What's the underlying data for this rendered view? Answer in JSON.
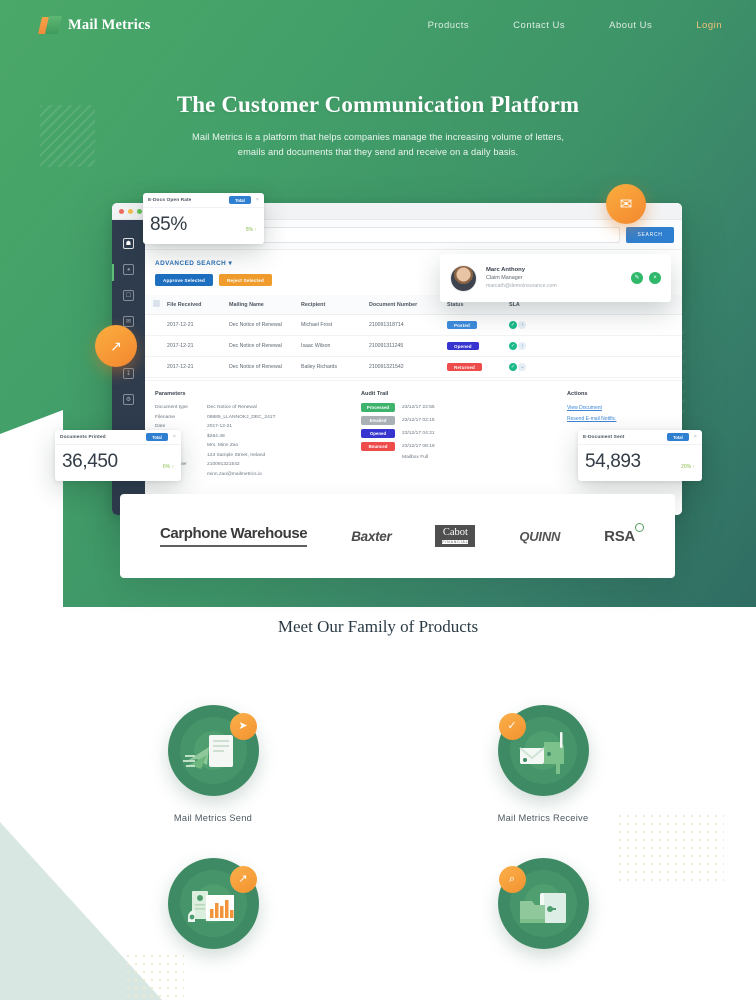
{
  "nav": {
    "brand": "Mail Metrics",
    "links": [
      {
        "label": "Products"
      },
      {
        "label": "Contact Us"
      },
      {
        "label": "About Us"
      },
      {
        "label": "Login"
      }
    ]
  },
  "hero": {
    "title": "The Customer Communication Platform",
    "subtitle": "Mail Metrics is a platform that helps companies manage the increasing volume of letters, emails and documents that they send and receive on a daily basis."
  },
  "dashboard": {
    "search_placeholder": "Search Here",
    "search_button": "SEARCH",
    "advanced_search": "ADVANCED SEARCH",
    "approve_button": "Approve Selected",
    "reject_button": "Reject Selected",
    "columns": [
      "File Received",
      "Mailing Name",
      "Recipient",
      "Document Number",
      "Status",
      "SLA"
    ],
    "rows": [
      {
        "date": "2017-12-21",
        "mailing": "Dec Notice of Renewal",
        "recipient": "Michael Frost",
        "document": "210091318714",
        "status": "Posted",
        "status_color": "#3d8bdd"
      },
      {
        "date": "2017-12-21",
        "mailing": "Dec Notice of Renewal",
        "recipient": "Isaac Wilson",
        "document": "210091311245",
        "status": "Opened",
        "status_color": "#3734cf"
      },
      {
        "date": "2017-12-21",
        "mailing": "Dec Notice of Renewal",
        "recipient": "Bailey Richards",
        "document": "210091321542",
        "status": "Returned",
        "status_color": "#ee4b4b"
      }
    ],
    "parameters": {
      "title": "Parameters",
      "items": [
        {
          "key": "Document type",
          "value": "Dec Notice of Renewal"
        },
        {
          "key": "Filename",
          "value": "09889_LLANNOKJ_DEC_241T"
        },
        {
          "key": "Date",
          "value": "2017-12-21"
        },
        {
          "key": "Premium",
          "value": "$264.48"
        },
        {
          "key": "Addressee",
          "value": "Mrs. Minn Zao"
        },
        {
          "key": "Address",
          "value": "123 Sample Street, Ireland"
        },
        {
          "key": "Policy Number",
          "value": "210091321542"
        },
        {
          "key": "Email",
          "value": "minn.zao@mailmetrics.io"
        }
      ]
    },
    "audit": {
      "title": "Audit Trail",
      "items": [
        {
          "label": "Processed",
          "time": "23/12/17 22:55",
          "note": ""
        },
        {
          "label": "Emailed",
          "time": "23/12/17 02:15",
          "note": ""
        },
        {
          "label": "Opened",
          "time": "23/12/17 04:21",
          "note": ""
        },
        {
          "label": "Bounced",
          "time": "23/12/17 08:19",
          "note": "Mailbox Full"
        }
      ]
    },
    "actions": {
      "title": "Actions",
      "links": [
        "View Document",
        "Resend E-mail Notific."
      ]
    },
    "stats": [
      {
        "label": "E-Docs Open Rate",
        "tag": "Total",
        "value": "85%",
        "delta": "8% ↑"
      },
      {
        "label": "Documents Printed",
        "tag": "Total",
        "value": "36,450",
        "delta": "6% ↑"
      },
      {
        "label": "E-Document Sent",
        "tag": "Total",
        "value": "54,893",
        "delta": "20% ↑"
      }
    ],
    "profile": {
      "name": "Marc Anthony",
      "role": "Claim Manager",
      "email": "marcath@demoinsurance.com"
    }
  },
  "clients": [
    {
      "name": "Carphone Warehouse"
    },
    {
      "name": "Baxter"
    },
    {
      "name": "Cabot",
      "sub": "FINANCIAL"
    },
    {
      "name": "QUINN"
    },
    {
      "name": "RSA"
    }
  ],
  "products": {
    "heading": "Meet Our Family of Products",
    "items": [
      {
        "label": "Mail Metrics Send",
        "badge": "➤"
      },
      {
        "label": "Mail Metrics Receive",
        "badge": "✓"
      },
      {
        "label": "",
        "badge": "↗"
      },
      {
        "label": "",
        "badge": "⌕"
      }
    ]
  },
  "colors": {
    "brand_green": "#43a069",
    "brand_orange": "#f3872f",
    "accent_blue": "#2f7fd1",
    "sidebar_dark": "#2e3c4e"
  }
}
